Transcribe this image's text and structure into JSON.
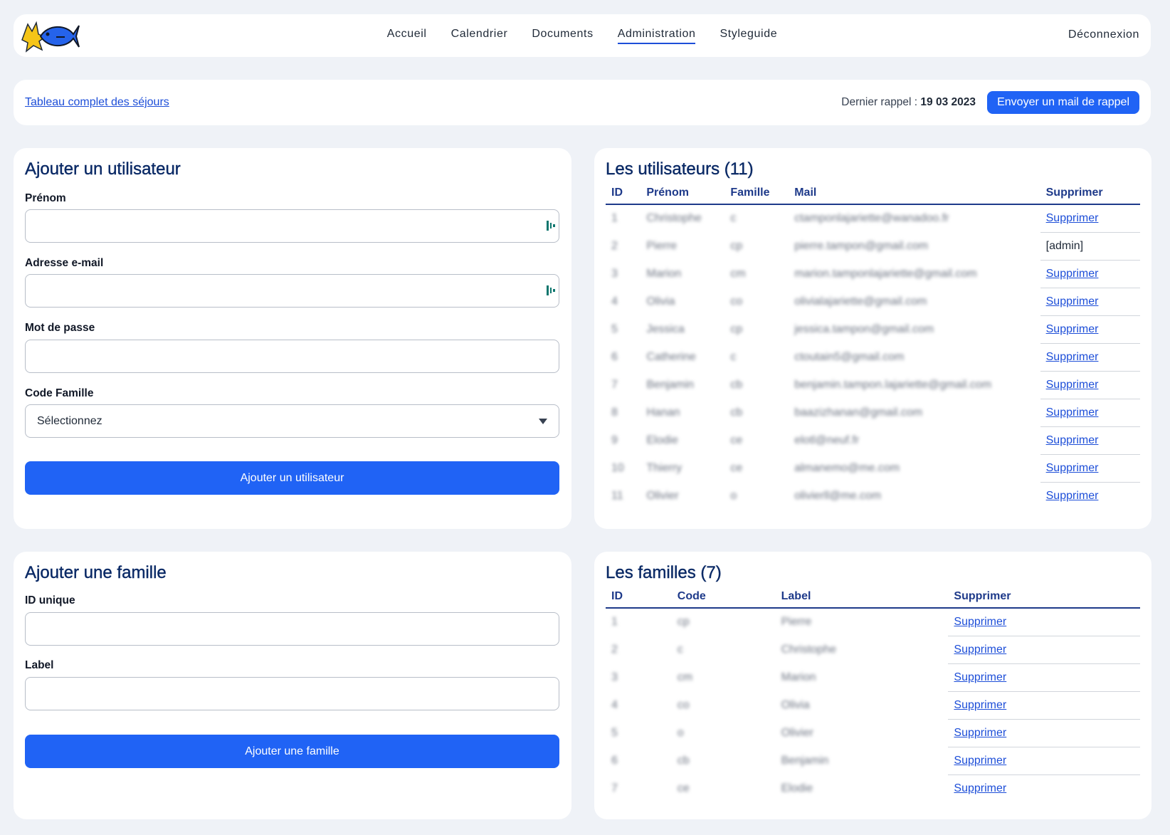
{
  "nav": {
    "items": [
      "Accueil",
      "Calendrier",
      "Documents",
      "Administration",
      "Styleguide"
    ],
    "active_index": 3,
    "logout": "Déconnexion"
  },
  "topbar": {
    "full_table_link": "Tableau complet des séjours",
    "last_reminder_label": "Dernier rappel :",
    "last_reminder_date": "19 03 2023",
    "send_reminder_button": "Envoyer un mail de rappel"
  },
  "add_user": {
    "title": "Ajouter un utilisateur",
    "firstname_label": "Prénom",
    "email_label": "Adresse e-mail",
    "password_label": "Mot de passe",
    "family_code_label": "Code Famille",
    "family_code_selected": "Sélectionnez",
    "submit": "Ajouter un utilisateur"
  },
  "users": {
    "title": "Les utilisateurs (11)",
    "headers": [
      "ID",
      "Prénom",
      "Famille",
      "Mail",
      "Supprimer"
    ],
    "rows": [
      {
        "id": "1",
        "firstname": "Christophe",
        "family": "c",
        "mail": "ctamponlajariette@wanadoo.fr",
        "action": "Supprimer"
      },
      {
        "id": "2",
        "firstname": "Pierre",
        "family": "cp",
        "mail": "pierre.tampon@gmail.com",
        "action": "[admin]"
      },
      {
        "id": "3",
        "firstname": "Marion",
        "family": "cm",
        "mail": "marion.tamponlajariette@gmail.com",
        "action": "Supprimer"
      },
      {
        "id": "4",
        "firstname": "Olivia",
        "family": "co",
        "mail": "olivialajariette@gmail.com",
        "action": "Supprimer"
      },
      {
        "id": "5",
        "firstname": "Jessica",
        "family": "cp",
        "mail": "jessica.tampon@gmail.com",
        "action": "Supprimer"
      },
      {
        "id": "6",
        "firstname": "Catherine",
        "family": "c",
        "mail": "ctoutain5@gmail.com",
        "action": "Supprimer"
      },
      {
        "id": "7",
        "firstname": "Benjamin",
        "family": "cb",
        "mail": "benjamin.tampon.lajariette@gmail.com",
        "action": "Supprimer"
      },
      {
        "id": "8",
        "firstname": "Hanan",
        "family": "cb",
        "mail": "baazizhanan@gmail.com",
        "action": "Supprimer"
      },
      {
        "id": "9",
        "firstname": "Elodie",
        "family": "ce",
        "mail": "elotl@neuf.fr",
        "action": "Supprimer"
      },
      {
        "id": "10",
        "firstname": "Thierry",
        "family": "ce",
        "mail": "almanemo@me.com",
        "action": "Supprimer"
      },
      {
        "id": "11",
        "firstname": "Olivier",
        "family": "o",
        "mail": "olivierll@me.com",
        "action": "Supprimer"
      }
    ]
  },
  "add_family": {
    "title": "Ajouter une famille",
    "id_label": "ID unique",
    "label_label": "Label",
    "submit": "Ajouter une famille"
  },
  "families": {
    "title": "Les familles (7)",
    "headers": [
      "ID",
      "Code",
      "Label",
      "Supprimer"
    ],
    "rows": [
      {
        "id": "1",
        "code": "cp",
        "label": "Pierre",
        "action": "Supprimer"
      },
      {
        "id": "2",
        "code": "c",
        "label": "Christophe",
        "action": "Supprimer"
      },
      {
        "id": "3",
        "code": "cm",
        "label": "Marion",
        "action": "Supprimer"
      },
      {
        "id": "4",
        "code": "co",
        "label": "Olivia",
        "action": "Supprimer"
      },
      {
        "id": "5",
        "code": "o",
        "label": "Olivier",
        "action": "Supprimer"
      },
      {
        "id": "6",
        "code": "cb",
        "label": "Benjamin",
        "action": "Supprimer"
      },
      {
        "id": "7",
        "code": "ce",
        "label": "Elodie",
        "action": "Supprimer"
      }
    ]
  },
  "colors": {
    "background": "#eff2f7",
    "primary": "#2063f5",
    "heading": "#0b2a66",
    "table_header": "#1e3a8a",
    "link": "#1d4ed8"
  }
}
